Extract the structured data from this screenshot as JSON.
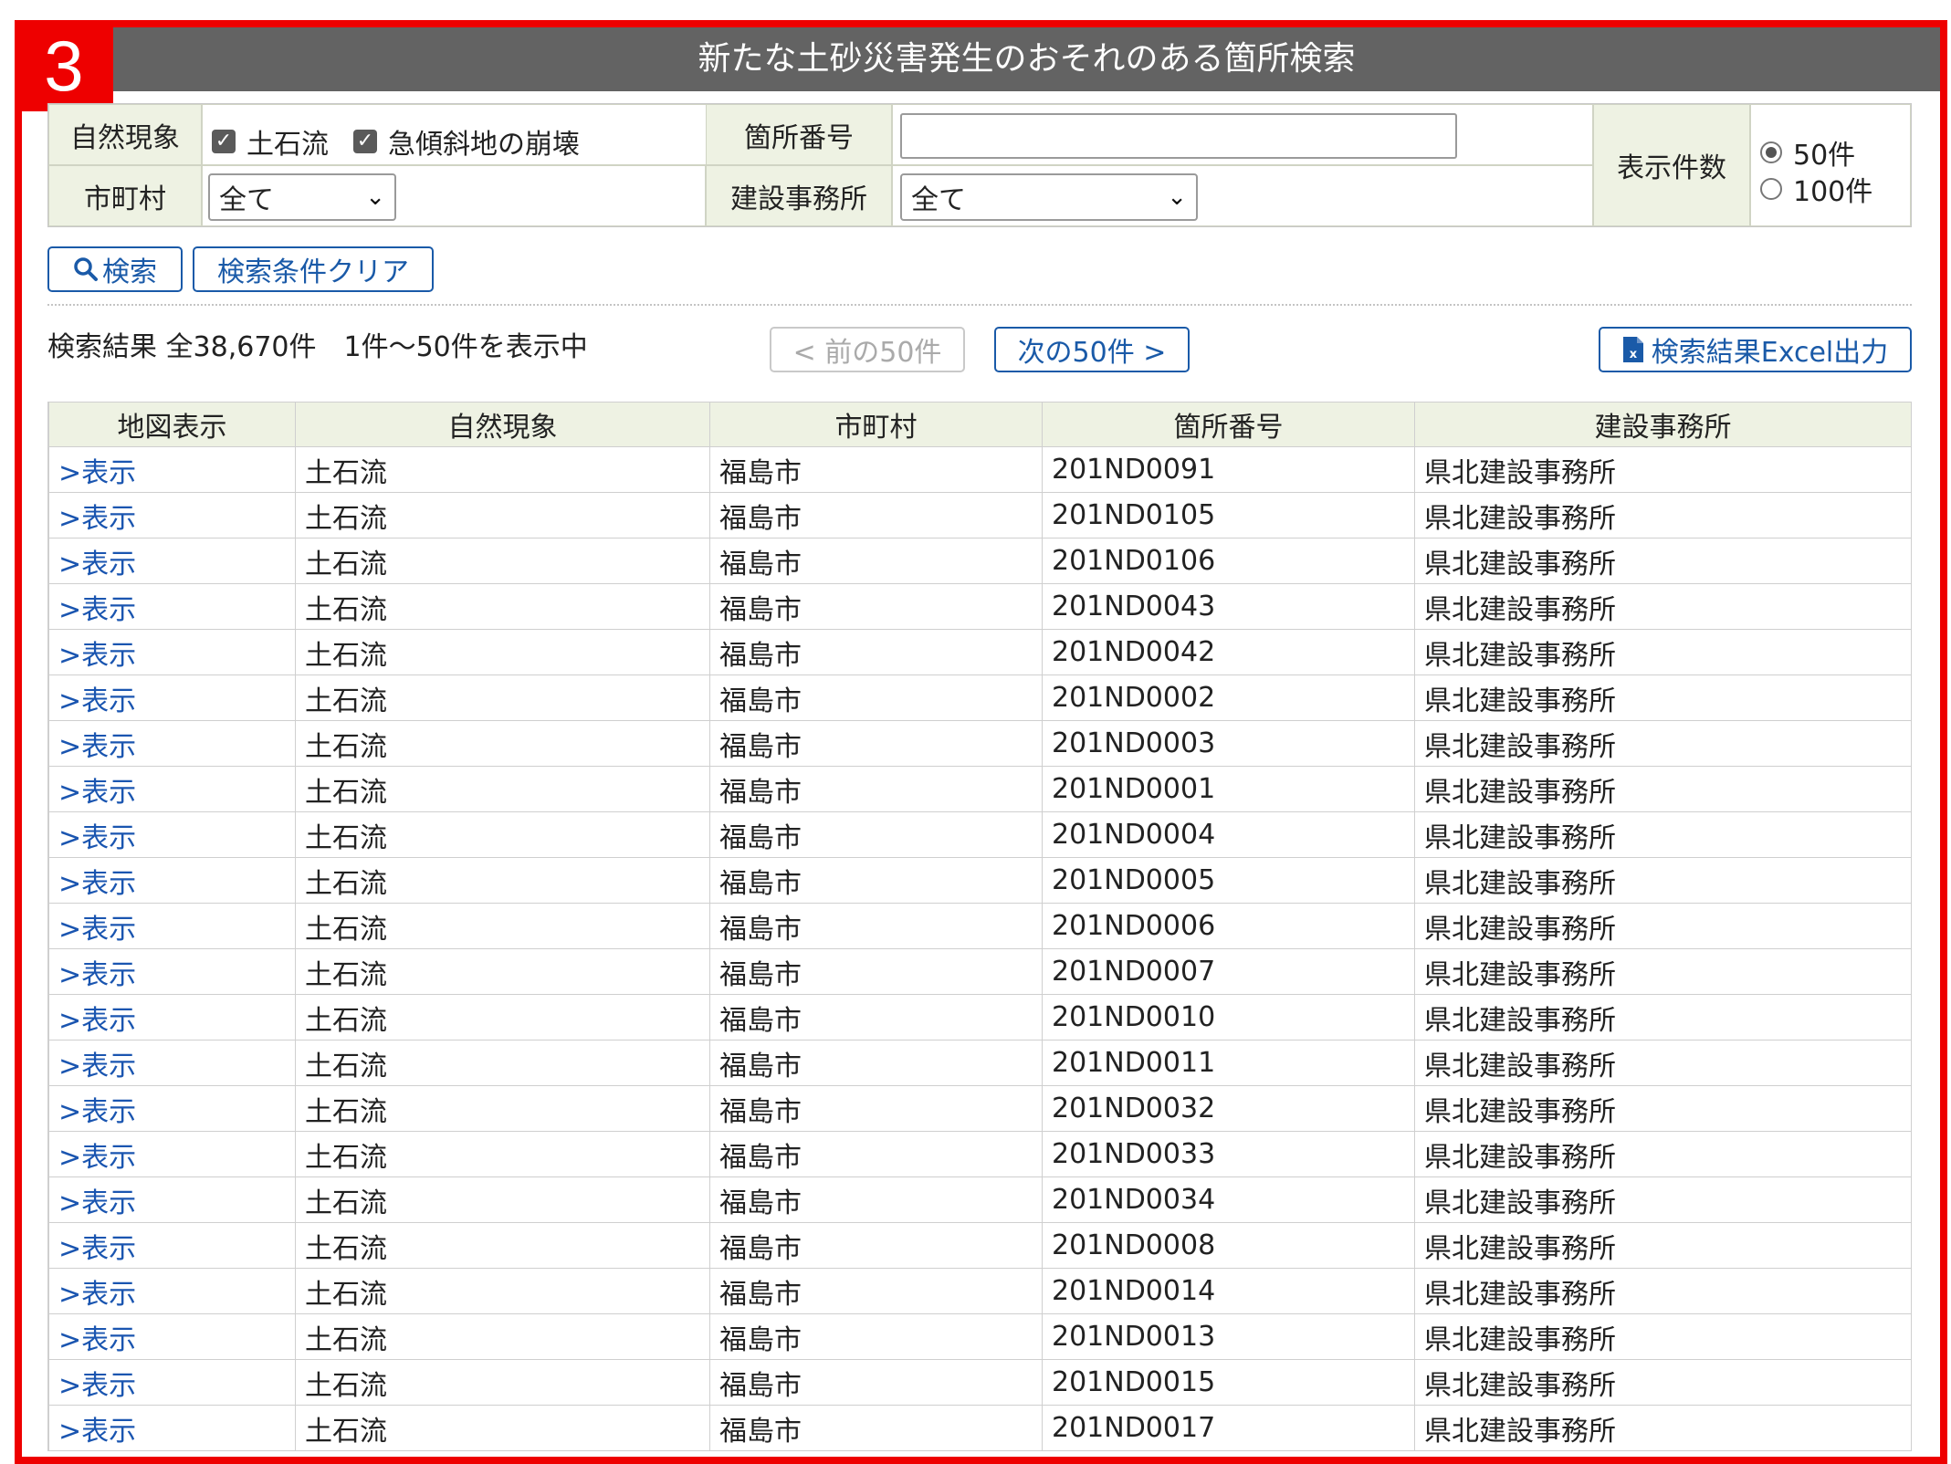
{
  "header": {
    "step_number": "3",
    "title": "新たな土砂災害発生のおそれのある箇所検索"
  },
  "form": {
    "phenomenon_label": "自然現象",
    "phenomenon_options": [
      {
        "label": "土石流",
        "checked": true
      },
      {
        "label": "急傾斜地の崩壊",
        "checked": true
      }
    ],
    "location_no_label": "箇所番号",
    "location_no_value": "",
    "municipality_label": "市町村",
    "municipality_value": "全て",
    "office_label": "建設事務所",
    "office_value": "全て",
    "display_count_label": "表示件数",
    "display_count_options": [
      {
        "label": "50件",
        "selected": true
      },
      {
        "label": "100件",
        "selected": false
      }
    ]
  },
  "buttons": {
    "search": "検索",
    "clear": "検索条件クリア",
    "prev": "< 前の50件",
    "next": "次の50件 >",
    "excel": "検索結果Excel出力"
  },
  "result_summary": "検索結果 全38,670件　1件～50件を表示中",
  "table": {
    "columns": [
      "地図表示",
      "自然現象",
      "市町村",
      "箇所番号",
      "建設事務所"
    ],
    "rows": [
      [
        ">表示",
        "土石流",
        "福島市",
        "201ND0091",
        "県北建設事務所"
      ],
      [
        ">表示",
        "土石流",
        "福島市",
        "201ND0105",
        "県北建設事務所"
      ],
      [
        ">表示",
        "土石流",
        "福島市",
        "201ND0106",
        "県北建設事務所"
      ],
      [
        ">表示",
        "土石流",
        "福島市",
        "201ND0043",
        "県北建設事務所"
      ],
      [
        ">表示",
        "土石流",
        "福島市",
        "201ND0042",
        "県北建設事務所"
      ],
      [
        ">表示",
        "土石流",
        "福島市",
        "201ND0002",
        "県北建設事務所"
      ],
      [
        ">表示",
        "土石流",
        "福島市",
        "201ND0003",
        "県北建設事務所"
      ],
      [
        ">表示",
        "土石流",
        "福島市",
        "201ND0001",
        "県北建設事務所"
      ],
      [
        ">表示",
        "土石流",
        "福島市",
        "201ND0004",
        "県北建設事務所"
      ],
      [
        ">表示",
        "土石流",
        "福島市",
        "201ND0005",
        "県北建設事務所"
      ],
      [
        ">表示",
        "土石流",
        "福島市",
        "201ND0006",
        "県北建設事務所"
      ],
      [
        ">表示",
        "土石流",
        "福島市",
        "201ND0007",
        "県北建設事務所"
      ],
      [
        ">表示",
        "土石流",
        "福島市",
        "201ND0010",
        "県北建設事務所"
      ],
      [
        ">表示",
        "土石流",
        "福島市",
        "201ND0011",
        "県北建設事務所"
      ],
      [
        ">表示",
        "土石流",
        "福島市",
        "201ND0032",
        "県北建設事務所"
      ],
      [
        ">表示",
        "土石流",
        "福島市",
        "201ND0033",
        "県北建設事務所"
      ],
      [
        ">表示",
        "土石流",
        "福島市",
        "201ND0034",
        "県北建設事務所"
      ],
      [
        ">表示",
        "土石流",
        "福島市",
        "201ND0008",
        "県北建設事務所"
      ],
      [
        ">表示",
        "土石流",
        "福島市",
        "201ND0014",
        "県北建設事務所"
      ],
      [
        ">表示",
        "土石流",
        "福島市",
        "201ND0013",
        "県北建設事務所"
      ],
      [
        ">表示",
        "土石流",
        "福島市",
        "201ND0015",
        "県北建設事務所"
      ],
      [
        ">表示",
        "土石流",
        "福島市",
        "201ND0017",
        "県北建設事務所"
      ]
    ]
  },
  "colors": {
    "frame": "#ee0000",
    "title_bar": "#636363",
    "label_bg": "#eef2e3",
    "link": "#1a55b0"
  }
}
